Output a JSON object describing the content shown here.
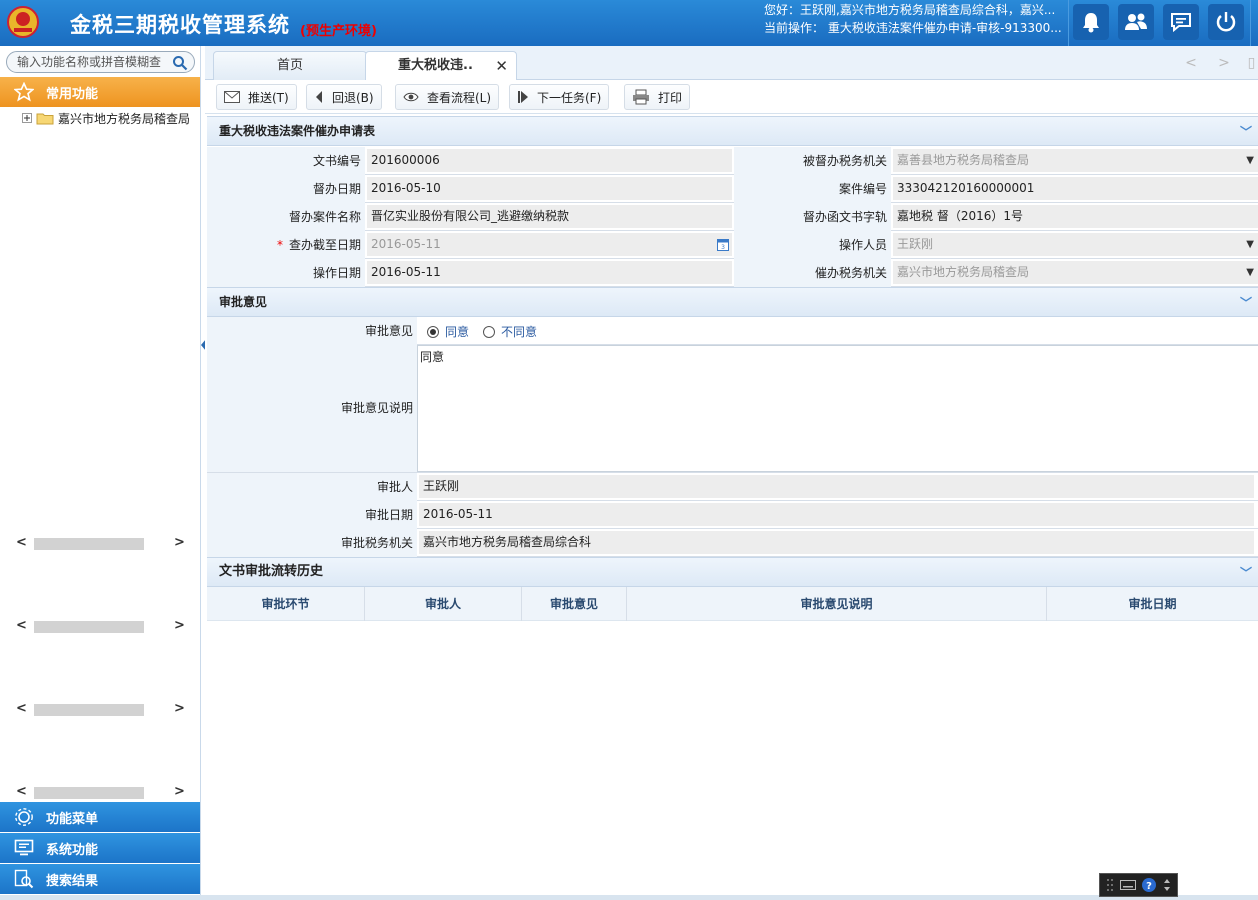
{
  "header": {
    "title": "金税三期税收管理系统",
    "env": "(预生产环境)",
    "greeting": "您好：王跃刚,嘉兴市地方税务局稽查局综合科，嘉兴...",
    "current_op": "当前操作：  重大税收违法案件催办申请-审核-913300...",
    "icons": [
      "bell-icon",
      "users-icon",
      "chat-icon",
      "power-icon"
    ]
  },
  "sidebar": {
    "search_placeholder": "输入功能名称或拼音模糊查",
    "common_label": "常用功能",
    "tree_root": "嘉兴市地方税务局稽查局",
    "menu_label": "功能菜单",
    "system_label": "系统功能",
    "search_results_label": "搜索结果"
  },
  "tabs": {
    "home": "首页",
    "active": "重大税收违.."
  },
  "toolbar": {
    "push": "推送(T)",
    "back": "回退(B)",
    "view_flow": "查看流程(L)",
    "next_task": "下一任务(F)",
    "print": "打印"
  },
  "form": {
    "section_title": "重大税收违法案件催办申请表",
    "doc_no_label": "文书编号",
    "doc_no": "201600006",
    "supervised_org_label": "被督办税务机关",
    "supervised_org": "嘉善县地方税务局稽查局",
    "supervise_date_label": "督办日期",
    "supervise_date": "2016-05-10",
    "case_no_label": "案件编号",
    "case_no": "333042120160000001",
    "case_name_label": "督办案件名称",
    "case_name": "晋亿实业股份有限公司_逃避缴纳税款",
    "letter_no_label": "督办函文书字轨",
    "letter_no": "嘉地税 督（2016）1号",
    "deadline_label": "查办截至日期",
    "deadline": "2016-05-11",
    "operator_label": "操作人员",
    "operator": "王跃刚",
    "op_date_label": "操作日期",
    "op_date": "2016-05-11",
    "urge_org_label": "催办税务机关",
    "urge_org": "嘉兴市地方税务局稽查局"
  },
  "approval": {
    "section_title": "审批意见",
    "opinion_label": "审批意见",
    "agree": "同意",
    "disagree": "不同意",
    "selected": "agree",
    "note_label": "审批意见说明",
    "note": "同意",
    "approver_label": "审批人",
    "approver": "王跃刚",
    "approve_date_label": "审批日期",
    "approve_date": "2016-05-11",
    "approve_org_label": "审批税务机关",
    "approve_org": "嘉兴市地方税务局稽查局综合科"
  },
  "history": {
    "section_title": "文书审批流转历史",
    "columns": [
      "审批环节",
      "审批人",
      "审批意见",
      "审批意见说明",
      "审批日期"
    ]
  },
  "colors": {
    "header_blue": "#1a6cc0",
    "accent_orange": "#ee9320",
    "env_red": "#e00000"
  }
}
